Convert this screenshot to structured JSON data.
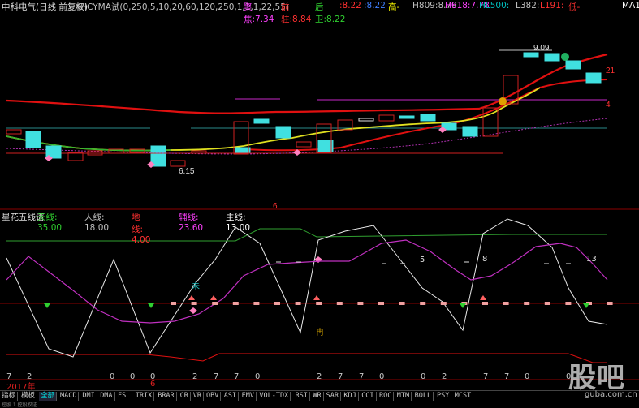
{
  "header": {
    "stock_title": "中科电气(日线 前复权)",
    "indicator": "XHCYMA试(0,250,5,10,20,60,120,250,1,1,1,22,55)",
    "items": [
      {
        "label": "聚焦:",
        "value": "7.34",
        "color": "#ff40ff"
      },
      {
        "label": "前驻:",
        "value": "8.84",
        "color": "#ff3030"
      },
      {
        "label": "后卫:",
        "value": "8.22",
        "color": "#30d030"
      },
      {
        "label": ":",
        "value": "8.22",
        "color": "#ff3030"
      },
      {
        "label": ":",
        "value": "8.22",
        "color": "#4080ff"
      },
      {
        "label": "高-",
        "value": "",
        "color": "#ffff00"
      },
      {
        "label": "H809:",
        "value": "8.79",
        "color": "#c0c0c0"
      },
      {
        "label": "H618:",
        "value": "7.78",
        "color": "#ff40ff"
      },
      {
        "label": "HL500:",
        "value": "",
        "color": "#00c0c0"
      },
      {
        "label": "L382:",
        "value": "",
        "color": "#c0c0c0"
      },
      {
        "label": "L191:",
        "value": "",
        "color": "#ff3030"
      },
      {
        "label": "低-",
        "value": "",
        "color": "#ff3030"
      },
      {
        "label": "MA1:",
        "value": "",
        "color": "#ffffff"
      }
    ]
  },
  "main_chart": {
    "annotations": {
      "high_price": "9.09",
      "low_price": "6.15",
      "right_marker_21": "21",
      "right_marker_4": "4",
      "mid_marker_6": "6"
    }
  },
  "sub_chart": {
    "title": "星花五线谱",
    "lines": [
      {
        "label": "天线:",
        "value": "35.00",
        "color": "#30d030"
      },
      {
        "label": "人线:",
        "value": "18.00",
        "color": "#c0c0c0"
      },
      {
        "label": "地线:",
        "value": "4.00",
        "color": "#ff3030"
      },
      {
        "label": "辅线:",
        "value": "23.60",
        "color": "#ff40ff"
      },
      {
        "label": "主线:",
        "value": "13.00",
        "color": "#ffffff"
      }
    ],
    "annotations": {
      "label_5": "5",
      "label_8": "8",
      "label_13": "13",
      "label_wei": "未",
      "label_ran": "冉"
    }
  },
  "counts_row": {
    "year": "2017年",
    "values": [
      "7",
      "2",
      "0",
      "0",
      "0",
      "2",
      "7",
      "7",
      "0",
      "2",
      "7",
      "7",
      "0",
      "0",
      "2",
      "7",
      "7",
      "0",
      "0"
    ],
    "marker_6": "6"
  },
  "tabs": [
    "指标",
    "模板",
    "全部",
    "MACD",
    "DMI",
    "DMA",
    "FSL",
    "TRIX",
    "BRAR",
    "CR",
    "VR",
    "OBV",
    "ASI",
    "EMV",
    "VOL-TDX",
    "RSI",
    "WR",
    "SAR",
    "KDJ",
    "CCI",
    "ROC",
    "MTM",
    "BOLL",
    "PSY",
    "MCST"
  ],
  "active_tab": "全部",
  "bottom_strip": "控股 1    控股权证",
  "watermark": {
    "big": "股吧",
    "small": "guba.com.cn"
  }
}
